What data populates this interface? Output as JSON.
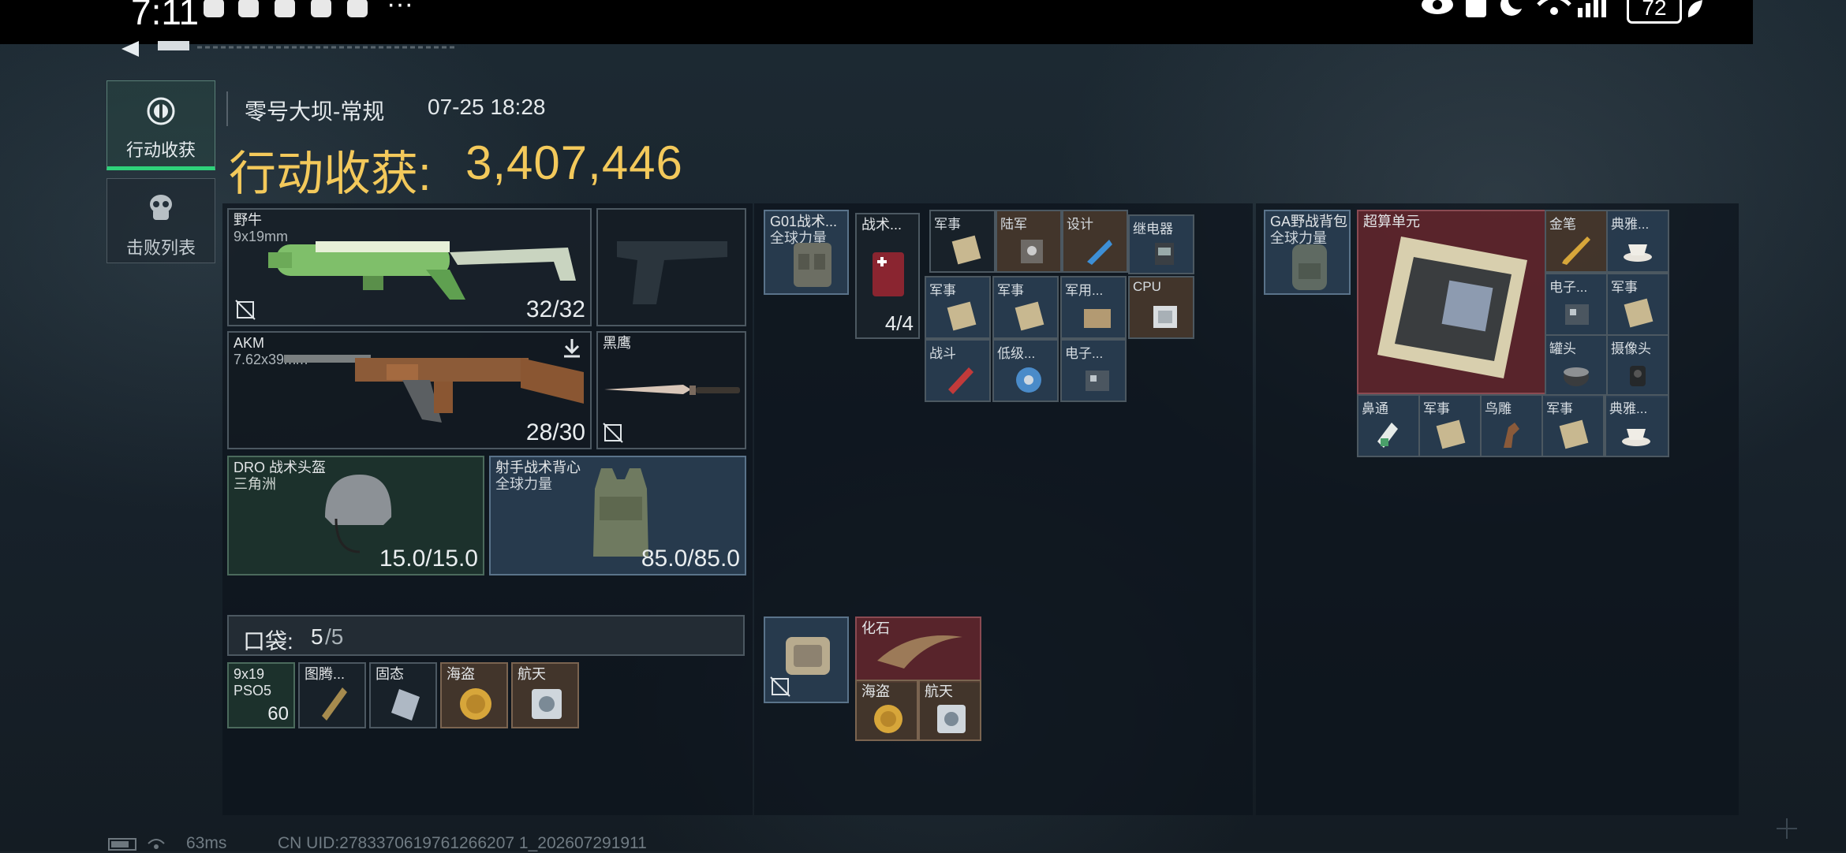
{
  "status_bar": {
    "time": "7:11",
    "more": "···",
    "battery": "72"
  },
  "tabs": [
    {
      "label": "行动收获"
    },
    {
      "label": "击败列表"
    }
  ],
  "header": {
    "map": "零号大坝-常规",
    "date": "07-25 18:28",
    "gain_label": "行动收获:",
    "gain_value": "3,407,446"
  },
  "loadout": {
    "primary1": {
      "name": "野牛",
      "ammo_type": "9x19mm",
      "ammo": "32/32"
    },
    "primary2": {
      "name": "AKM",
      "ammo_type": "7.62x39mm",
      "ammo": "28/30"
    },
    "melee": {
      "name": "黑鹰"
    },
    "helmet": {
      "name": "DRO 战术头盔",
      "origin": "三角洲",
      "durability": "15.0/15.0"
    },
    "armor": {
      "name": "射手战术背心",
      "origin": "全球力量",
      "durability": "85.0/85.0"
    },
    "pocket": {
      "label": "口袋:",
      "count": "5",
      "capacity": "/5"
    },
    "pocket_items": [
      {
        "name": "9x19",
        "sub": "PSO5",
        "count": "60"
      },
      {
        "name": "图腾..."
      },
      {
        "name": "固态"
      },
      {
        "name": "海盗"
      },
      {
        "name": "航天"
      }
    ]
  },
  "chest_rig": {
    "name": "G01战术...",
    "origin": "全球力量"
  },
  "rig_items": [
    {
      "name": "战术...",
      "count": "4/4"
    },
    {
      "name": "军事"
    },
    {
      "name": "陆军"
    },
    {
      "name": "设计"
    },
    {
      "name": "继电器"
    },
    {
      "name": "军事"
    },
    {
      "name": "军事"
    },
    {
      "name": "军用..."
    },
    {
      "name": "CPU"
    },
    {
      "name": "战斗"
    },
    {
      "name": "低级..."
    },
    {
      "name": "电子..."
    }
  ],
  "safe_box": {
    "items": [
      {
        "name": "化石"
      },
      {
        "name": "海盗"
      },
      {
        "name": "航天"
      }
    ]
  },
  "backpack": {
    "name": "GA野战背包",
    "origin": "全球力量"
  },
  "backpack_items": [
    {
      "name": "超算单元"
    },
    {
      "name": "金笔"
    },
    {
      "name": "典雅..."
    },
    {
      "name": "电子..."
    },
    {
      "name": "军事"
    },
    {
      "name": "罐头"
    },
    {
      "name": "摄像头"
    },
    {
      "name": "鼻通"
    },
    {
      "name": "军事"
    },
    {
      "name": "鸟雕"
    },
    {
      "name": "军事"
    },
    {
      "name": "典雅..."
    }
  ],
  "footer": {
    "ping": "63ms",
    "uid": "CN UID:2783370619761266207 1_202607291911"
  }
}
